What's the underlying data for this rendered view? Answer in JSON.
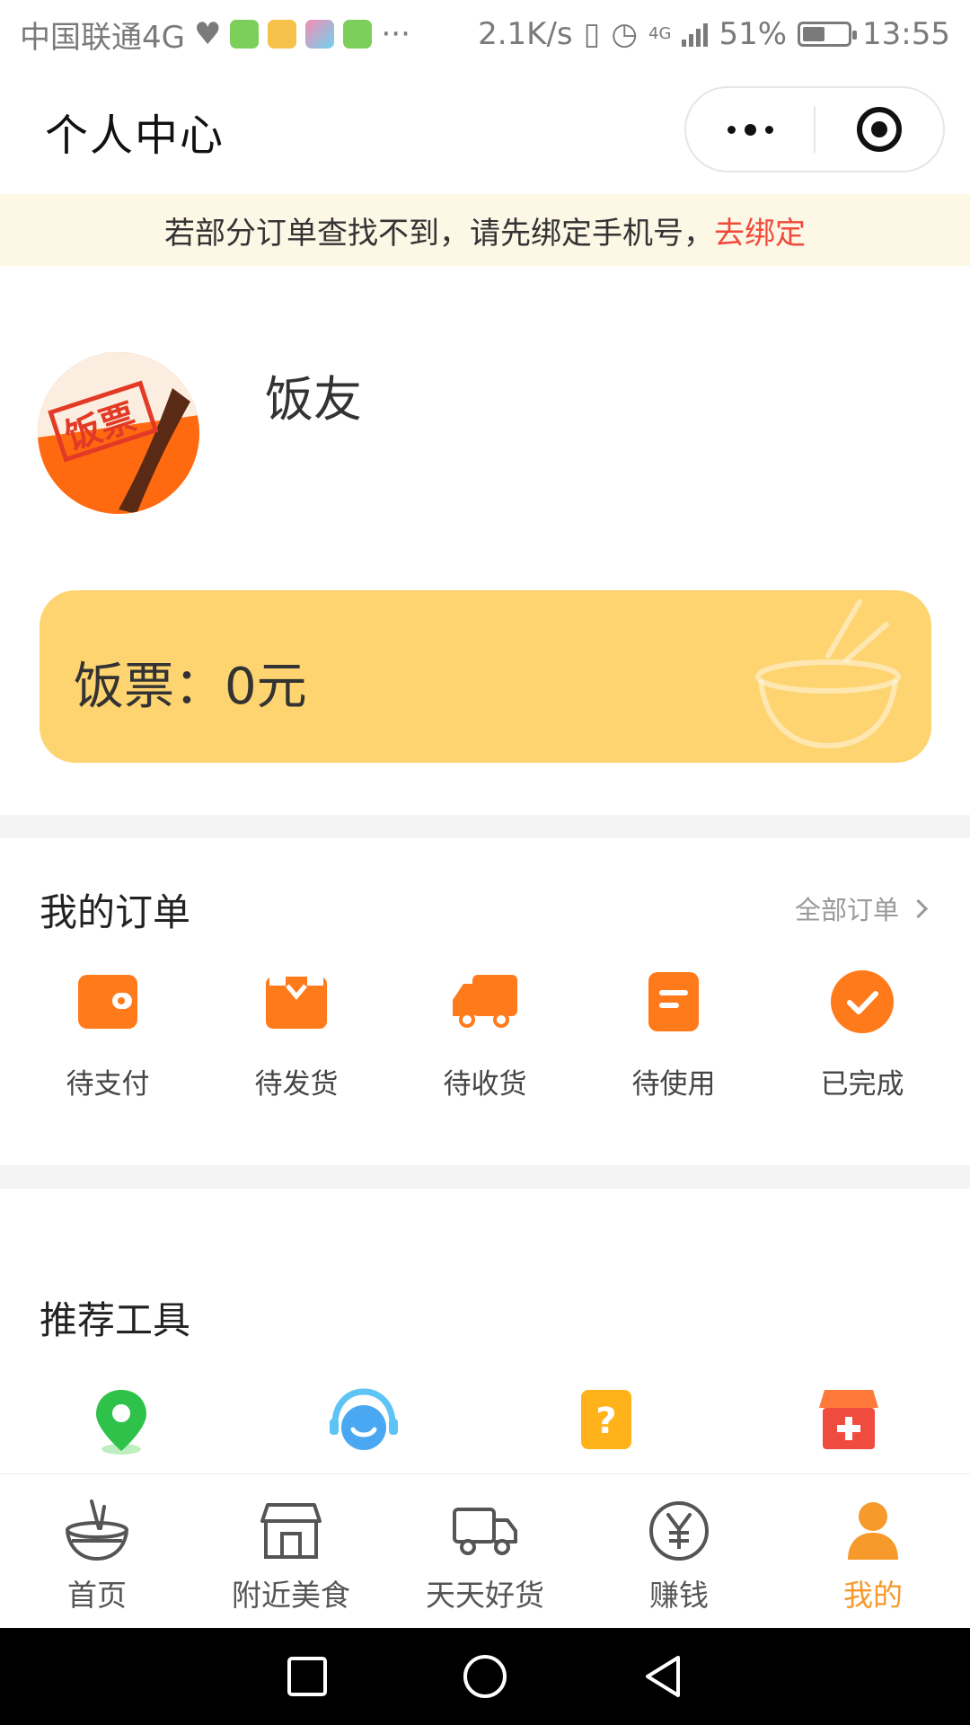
{
  "status_bar": {
    "carrier": "中国联通4G",
    "more": "···",
    "speed": "2.1K/s",
    "network": "4G",
    "battery": "51%",
    "battery_level": 0.51,
    "time": "13:55"
  },
  "header": {
    "title": "个人中心"
  },
  "notice": {
    "text": "若部分订单查找不到，请先绑定手机号，",
    "link": "去绑定",
    "link_color": "#f04a3c"
  },
  "profile": {
    "nickname": "饭友",
    "avatar_text": "饭票"
  },
  "card": {
    "label": "饭票：0元",
    "background": "#fdd470"
  },
  "orders": {
    "title": "我的订单",
    "all_label": "全部订单",
    "items": [
      {
        "label": "待支付",
        "icon": "wallet-icon"
      },
      {
        "label": "待发货",
        "icon": "package-icon"
      },
      {
        "label": "待收货",
        "icon": "truck-icon"
      },
      {
        "label": "待使用",
        "icon": "document-icon"
      },
      {
        "label": "已完成",
        "icon": "check-circle-icon"
      }
    ]
  },
  "tools": {
    "title": "推荐工具",
    "items": [
      {
        "icon": "location-pin-icon"
      },
      {
        "icon": "customer-service-icon"
      },
      {
        "icon": "help-icon"
      },
      {
        "icon": "store-icon"
      }
    ]
  },
  "tabbar": {
    "items": [
      {
        "label": "首页",
        "icon": "bowl-icon"
      },
      {
        "label": "附近美食",
        "icon": "shop-icon"
      },
      {
        "label": "天天好货",
        "icon": "truck-icon"
      },
      {
        "label": "赚钱",
        "icon": "yen-icon"
      },
      {
        "label": "我的",
        "icon": "user-icon",
        "active": true
      }
    ],
    "active_color": "#f59a2b"
  },
  "colors": {
    "accent_orange": "#ff6a10",
    "icon_orange": "#ff7a1a"
  }
}
